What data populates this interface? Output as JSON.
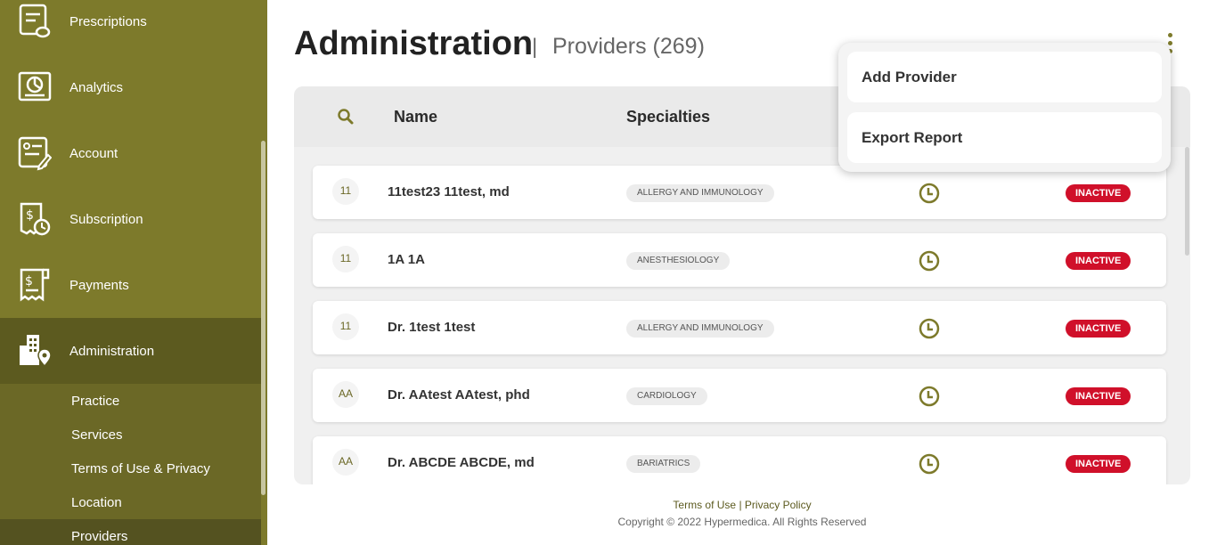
{
  "sidebar": {
    "items": [
      {
        "label": "Prescriptions",
        "icon": "prescription-icon"
      },
      {
        "label": "Analytics",
        "icon": "analytics-icon"
      },
      {
        "label": "Account",
        "icon": "account-icon"
      },
      {
        "label": "Subscription",
        "icon": "subscription-icon"
      },
      {
        "label": "Payments",
        "icon": "payments-icon"
      },
      {
        "label": "Administration",
        "icon": "building-location-icon"
      }
    ],
    "subitems": [
      {
        "label": "Practice"
      },
      {
        "label": "Services"
      },
      {
        "label": "Terms of Use & Privacy"
      },
      {
        "label": "Location"
      },
      {
        "label": "Providers"
      }
    ]
  },
  "header": {
    "title": "Administration",
    "separator": "|",
    "subtitle": "Providers (269)"
  },
  "menu": {
    "add_provider": "Add Provider",
    "export_report": "Export Report"
  },
  "table": {
    "columns": {
      "name": "Name",
      "specialties": "Specialties"
    },
    "rows": [
      {
        "initials": "11",
        "name": "11test23 11test, md",
        "specialty": "ALLERGY AND IMMUNOLOGY",
        "status": "INACTIVE"
      },
      {
        "initials": "11",
        "name": "1A 1A",
        "specialty": "ANESTHESIOLOGY",
        "status": "INACTIVE"
      },
      {
        "initials": "11",
        "name": "Dr. 1test 1test",
        "specialty": "ALLERGY AND IMMUNOLOGY",
        "status": "INACTIVE"
      },
      {
        "initials": "AA",
        "name": "Dr. AAtest AAtest, phd",
        "specialty": "CARDIOLOGY",
        "status": "INACTIVE"
      },
      {
        "initials": "AA",
        "name": "Dr. ABCDE ABCDE, md",
        "specialty": "BARIATRICS",
        "status": "INACTIVE"
      }
    ]
  },
  "footer": {
    "terms": "Terms of Use",
    "divider": "|",
    "privacy": "Privacy Policy",
    "copyright": "Copyright © 2022 Hypermedica. All Rights Reserved"
  },
  "colors": {
    "sidebar": "#7d7a2b",
    "accent": "#7d7a2b",
    "status_inactive": "#d0102a"
  }
}
